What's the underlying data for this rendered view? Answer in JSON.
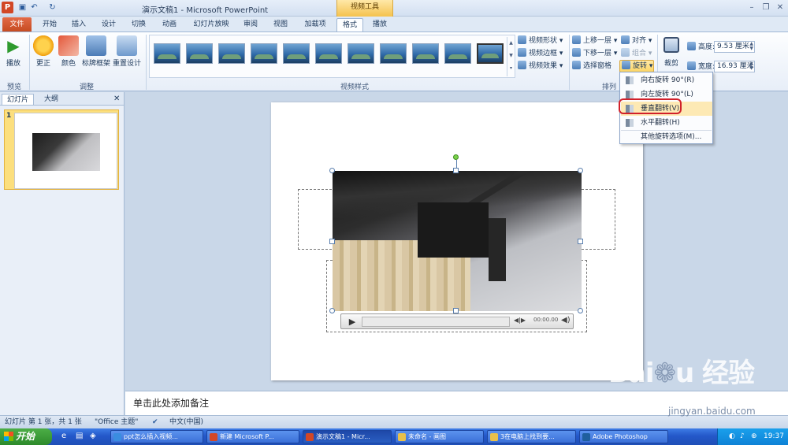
{
  "titlebar": {
    "title": "演示文稿1 - Microsoft PowerPoint",
    "context_tool": "视频工具"
  },
  "tabs": [
    "文件",
    "开始",
    "插入",
    "设计",
    "切换",
    "动画",
    "幻灯片放映",
    "审阅",
    "视图",
    "加载项",
    "格式",
    "播放"
  ],
  "ribbon": {
    "preview": {
      "play": "播放",
      "group": "预览"
    },
    "adjust": {
      "correct": "更正",
      "color": "颜色",
      "poster_frame": "标牌框架",
      "reset": "重置设计",
      "group": "调整"
    },
    "video_styles": {
      "shape": "视频形状",
      "border": "视频边框",
      "effects": "视频效果",
      "group": "视频样式"
    },
    "arrange": {
      "bring_forward": "上移一层",
      "send_backward": "下移一层",
      "selection_pane": "选择窗格",
      "align": "对齐",
      "group_btn": "组合",
      "rotate": "旋转",
      "group": "排列"
    },
    "size": {
      "crop": "裁剪",
      "height_label": "高度:",
      "height_value": "9.53 厘米",
      "width_label": "宽度:",
      "width_value": "16.93 厘米"
    }
  },
  "left_pane": {
    "tab_slides": "幻灯片",
    "tab_outline": "大纲",
    "slide_number": "1"
  },
  "rotate_menu": {
    "items": [
      "向右旋转 90°(R)",
      "向左旋转 90°(L)",
      "垂直翻转(V)",
      "水平翻转(H)",
      "其他旋转选项(M)..."
    ]
  },
  "video_player": {
    "time": "00:00.00"
  },
  "notes": {
    "placeholder": "单击此处添加备注"
  },
  "statusbar": {
    "slide_info": "幻灯片 第 1 张，共 1 张",
    "theme": "\"Office 主题\"",
    "language": "中文(中国)"
  },
  "taskbar": {
    "start": "开始",
    "items": [
      "ppt怎么插入视频...",
      "新建 Microsoft P...",
      "演示文稿1 - Micr...",
      "未命名 - 画图",
      "3在电脑上找到要...",
      "Adobe Photoshop"
    ],
    "clock": "19:37"
  },
  "watermark": {
    "brand": "Baidu 经验",
    "url": "jingyan.baidu.com"
  },
  "colors": {
    "file_tab": "#c44a1f",
    "context_tool": "#f4c24e",
    "highlight_box": "#d1202a",
    "taskbar": "#2458c9"
  }
}
